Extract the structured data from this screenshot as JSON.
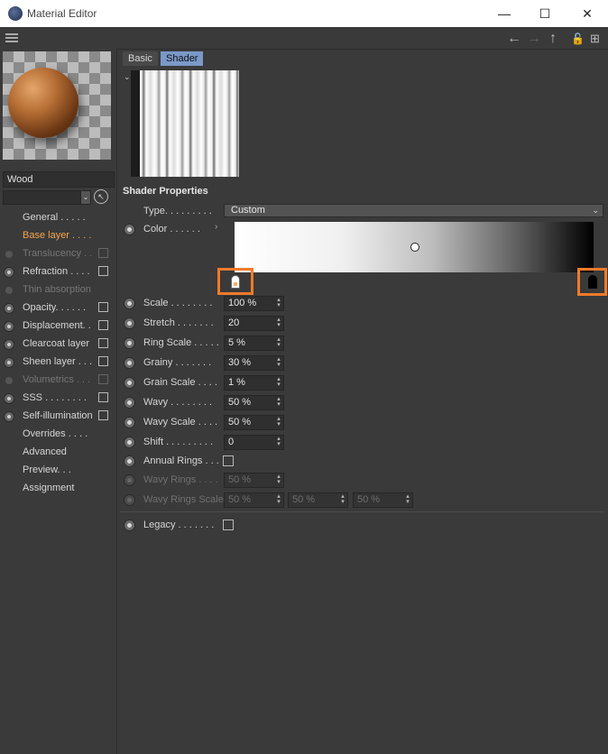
{
  "window": {
    "title": "Material Editor",
    "minimize": "—",
    "maximize": "☐",
    "close": "✕"
  },
  "toolbar": {
    "back": "←",
    "forward": "→",
    "up": "↑",
    "lock": "🔓",
    "new": "⊞"
  },
  "material": {
    "name": "Wood",
    "picker": "↖"
  },
  "channels": [
    {
      "label": "General . . . . .",
      "dot": "none",
      "checkbox": false,
      "state": "normal"
    },
    {
      "label": "Base layer . . . .",
      "dot": "none",
      "checkbox": false,
      "state": "active"
    },
    {
      "label": "Translucency . .",
      "dot": "small",
      "checkbox": true,
      "state": "dim"
    },
    {
      "label": "Refraction . . . .",
      "dot": "big",
      "checkbox": true,
      "state": "normal"
    },
    {
      "label": "Thin absorption",
      "dot": "small",
      "checkbox": false,
      "state": "dim"
    },
    {
      "label": "Opacity. . . . . .",
      "dot": "big",
      "checkbox": true,
      "state": "normal"
    },
    {
      "label": "Displacement. .",
      "dot": "big",
      "checkbox": true,
      "state": "normal"
    },
    {
      "label": "Clearcoat layer",
      "dot": "big",
      "checkbox": true,
      "state": "normal"
    },
    {
      "label": "Sheen layer . . .",
      "dot": "big",
      "checkbox": true,
      "state": "normal"
    },
    {
      "label": "Volumetrics . . .",
      "dot": "small",
      "checkbox": true,
      "state": "dim"
    },
    {
      "label": "SSS . . . . . . . .",
      "dot": "big",
      "checkbox": true,
      "state": "normal"
    },
    {
      "label": "Self-illumination",
      "dot": "big",
      "checkbox": true,
      "state": "normal"
    },
    {
      "label": "Overrides . . . .",
      "dot": "none",
      "checkbox": false,
      "state": "normal"
    },
    {
      "label": "Advanced",
      "dot": "none",
      "checkbox": false,
      "state": "normal"
    },
    {
      "label": "Preview. . .",
      "dot": "none",
      "checkbox": false,
      "state": "normal"
    },
    {
      "label": "Assignment",
      "dot": "none",
      "checkbox": false,
      "state": "normal"
    }
  ],
  "tabs": {
    "basic": "Basic",
    "shader": "Shader"
  },
  "section_title": "Shader Properties",
  "type": {
    "label": "Type. . . . . . . . .",
    "value": "Custom"
  },
  "color": {
    "label": "Color . . . . . ."
  },
  "params": [
    {
      "label": "Scale . . . . . . . .",
      "value": "100 %"
    },
    {
      "label": "Stretch . . . . . . .",
      "value": "20"
    },
    {
      "label": "Ring Scale . . . . .",
      "value": "5 %"
    },
    {
      "label": "Grainy . . . . . . .",
      "value": "30 %"
    },
    {
      "label": "Grain Scale . . . .",
      "value": "1 %"
    },
    {
      "label": "Wavy . . . . . . . .",
      "value": "50 %"
    },
    {
      "label": "Wavy Scale . . . .",
      "value": "50 %"
    },
    {
      "label": "Shift . . . . . . . . .",
      "value": "0"
    }
  ],
  "annual_rings": {
    "label": "Annual Rings . . ."
  },
  "wavy_rings": {
    "label": "Wavy Rings . . . .",
    "value": "50 %"
  },
  "wavy_rings_scale": {
    "label": "Wavy Rings Scale",
    "values": [
      "50 %",
      "50 %",
      "50 %"
    ]
  },
  "legacy": {
    "label": "Legacy . . . . . . ."
  }
}
